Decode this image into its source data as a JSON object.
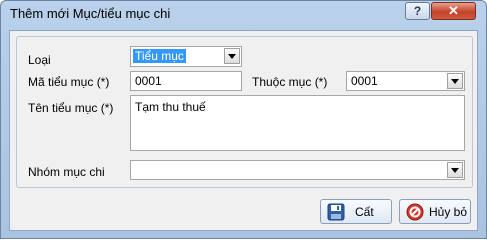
{
  "window": {
    "title": "Thêm mới Mục/tiểu mục chi",
    "help_symbol": "?",
    "close_symbol": "✕"
  },
  "form": {
    "loai": {
      "label": "Loại",
      "value": "Tiểu mục"
    },
    "ma_tieu_muc": {
      "label": "Mã tiểu mục (*)",
      "value": "0001"
    },
    "thuoc_muc": {
      "label": "Thuộc mục (*)",
      "value": "0001"
    },
    "ten_tieu_muc": {
      "label": "Tên tiểu mục (*)",
      "value": "Tạm thu thuế"
    },
    "nhom_muc_chi": {
      "label": "Nhóm mục chi",
      "value": ""
    }
  },
  "buttons": {
    "save_label": "Cất",
    "cancel_label": "Hủy bỏ"
  },
  "colors": {
    "selection": "#3399ff",
    "titlebar": "#b9d1ea",
    "close": "#c2432a"
  },
  "icons": {
    "save": "floppy-disk-icon",
    "cancel": "cancel-circle-icon",
    "dropdown": "chevron-down-icon"
  }
}
